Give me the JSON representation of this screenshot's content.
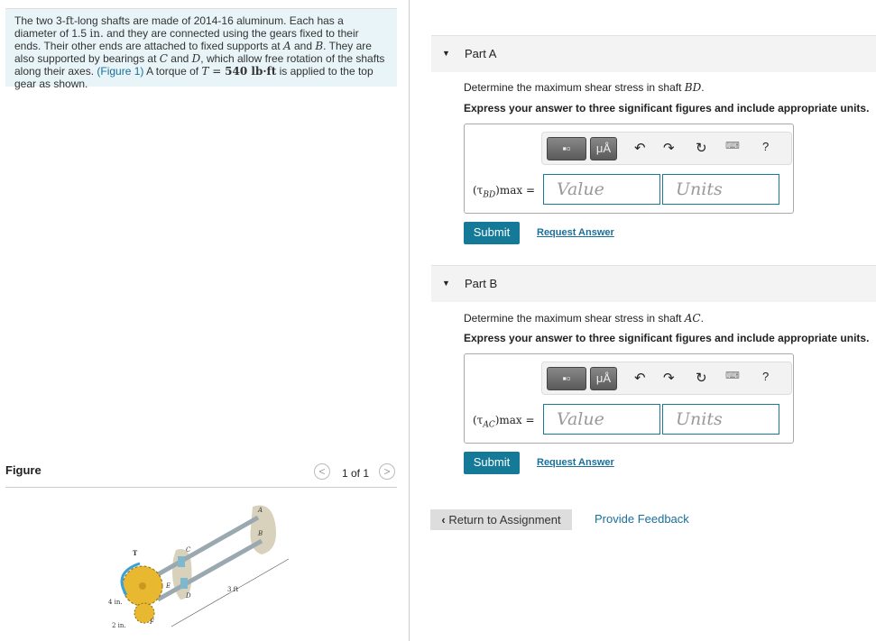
{
  "problem": {
    "t1": "The two 3-",
    "u_ft": "ft",
    "t2": "-long shafts are made of 2014-16 aluminum. Each has a diameter of 1.5 ",
    "u_in": "in.",
    "t3": " and they are connected using the gears fixed to their ends. Their other ends are attached to fixed supports at ",
    "A": "A",
    "t4": " and ",
    "B": "B",
    "t5": ". They are also supported by bearings at ",
    "C": "C",
    "t6": " and ",
    "D": "D",
    "t7": ", which allow free rotation of the shafts along their axes. ",
    "figlink": "(Figure 1)",
    "t8": " A torque of ",
    "T": "T",
    "eq": " = ",
    "val": "540 lb·ft",
    "t9": " is applied to the top gear as shown."
  },
  "figure": {
    "title": "Figure",
    "pager": "1 of 1",
    "labels": {
      "T": "T",
      "A": "A",
      "B": "B",
      "C": "C",
      "D": "D",
      "E": "E",
      "F": "F",
      "len": "3 ft",
      "r1": "4 in.",
      "r2": "2 in."
    }
  },
  "parts": [
    {
      "label": "Part A",
      "q1": "Determine the maximum shear stress in shaft ",
      "shaft": "BD",
      "q2": ".",
      "instr": "Express your answer to three significant figures and include appropriate units.",
      "lhs_sym": "(τ",
      "lhs_sub": "BD",
      "lhs_tail": ")max =",
      "value_ph": "Value",
      "units_ph": "Units",
      "submit": "Submit",
      "request": "Request Answer"
    },
    {
      "label": "Part B",
      "q1": "Determine the maximum shear stress in shaft ",
      "shaft": "AC",
      "q2": ".",
      "instr": "Express your answer to three significant figures and include appropriate units.",
      "lhs_sym": "(τ",
      "lhs_sub": "AC",
      "lhs_tail": ")max =",
      "value_ph": "Value",
      "units_ph": "Units",
      "submit": "Submit",
      "request": "Request Answer"
    }
  ],
  "toolbar": {
    "units": "μÅ",
    "help": "?"
  },
  "footer": {
    "return": "Return to Assignment",
    "feedback": "Provide Feedback"
  }
}
